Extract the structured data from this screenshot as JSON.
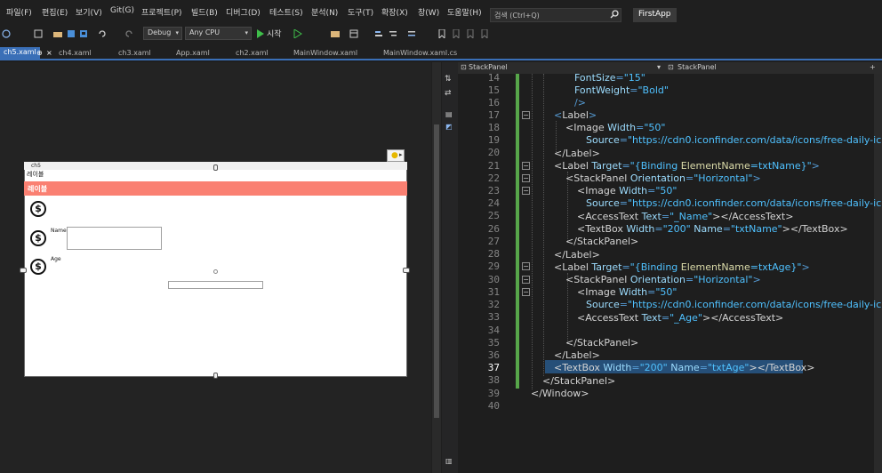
{
  "menu": [
    "파일(F)",
    "편집(E)",
    "보기(V)",
    "Git(G)",
    "프로젝트(P)",
    "빌드(B)",
    "디버그(D)",
    "테스트(S)",
    "분석(N)",
    "도구(T)",
    "확장(X)",
    "창(W)",
    "도움말(H)"
  ],
  "search": {
    "placeholder": "검색 (Ctrl+Q)"
  },
  "app_name": "FirstApp",
  "toolbar": {
    "config": "Debug",
    "platform": "Any CPU",
    "start": "시작"
  },
  "tabs": [
    "ch5.xaml",
    "ch4.xaml",
    "ch3.xaml",
    "App.xaml",
    "ch2.xaml",
    "MainWindow.xaml",
    "MainWindow.xaml.cs"
  ],
  "designer": {
    "window_title": "ch5",
    "label_top": "레이블",
    "label_highlight": "레이블",
    "name_label": "Name",
    "age_label": "Age"
  },
  "editor": {
    "left_dropdown": "StackPanel",
    "right_dropdown": "StackPanel",
    "line_numbers": [
      "14",
      "15",
      "16",
      "17",
      "18",
      "19",
      "20",
      "21",
      "22",
      "23",
      "24",
      "25",
      "26",
      "27",
      "28",
      "29",
      "30",
      "31",
      "32",
      "33",
      "34",
      "35",
      "36",
      "37",
      "38",
      "39",
      "40"
    ],
    "code": {
      "l14": {
        "attr": "FontSize",
        "val": "\"15\""
      },
      "l15": {
        "attr": "FontWeight",
        "val": "\"Bold\""
      },
      "l16": "/>",
      "l17": {
        "open": "<",
        "tag": "Label",
        "close": ">"
      },
      "l18": {
        "tag": "<Image",
        "attr": "Width",
        "val": "\"50\""
      },
      "l19": {
        "attr": "Source",
        "val": "\"https://cdn0.iconfinder.com/data/icons/free-daily-ic"
      },
      "l20": "</Label>",
      "l21": {
        "tag": "<Label",
        "attr": "Target",
        "val1": "\"{Binding ",
        "bind": "ElementName",
        "val2": "=txtName}\"",
        "close": ">"
      },
      "l22": {
        "tag": "<StackPanel",
        "attr": "Orientation",
        "val": "\"Horizontal\"",
        "close": ">"
      },
      "l23": {
        "tag": "<Image",
        "attr": "Width",
        "val": "\"50\""
      },
      "l24": {
        "attr": "Source",
        "val": "\"https://cdn0.iconfinder.com/data/icons/free-daily-ic"
      },
      "l25": {
        "tag": "<AccessText",
        "attr": "Text",
        "val": "\"_Name\"",
        "close": "></AccessText>"
      },
      "l26": {
        "tag": "<TextBox",
        "attr1": "Width",
        "val1": "\"200\"",
        "attr2": "Name",
        "val2": "\"txtName\"",
        "close": "></TextBox>"
      },
      "l27": "</StackPanel>",
      "l28": "</Label>",
      "l29": {
        "tag": "<Label",
        "attr": "Target",
        "val1": "\"{Binding ",
        "bind": "ElementName",
        "val2": "=txtAge}\"",
        "close": ">"
      },
      "l30": {
        "tag": "<StackPanel",
        "attr": "Orientation",
        "val": "\"Horizontal\"",
        "close": ">"
      },
      "l31": {
        "tag": "<Image",
        "attr": "Width",
        "val": "\"50\""
      },
      "l32": {
        "attr": "Source",
        "val": "\"https://cdn0.iconfinder.com/data/icons/free-daily-ic"
      },
      "l33": {
        "tag": "<AccessText",
        "attr": "Text",
        "val": "\"_Age\"",
        "close": "></AccessText>"
      },
      "l35": "</StackPanel>",
      "l36": "</Label>",
      "l37": {
        "tag": "<TextBox",
        "attr1": "Width",
        "val1": "\"200\"",
        "attr2": "Name",
        "val2": "\"txtAge\"",
        "close": "></TextBox>"
      },
      "l38": "</StackPanel>",
      "l39": "</Window>"
    }
  },
  "colors": {
    "accent": "#3a6fb7",
    "highlight": "#fa8072",
    "changebar": "#57a64a",
    "selection": "#264f78"
  }
}
